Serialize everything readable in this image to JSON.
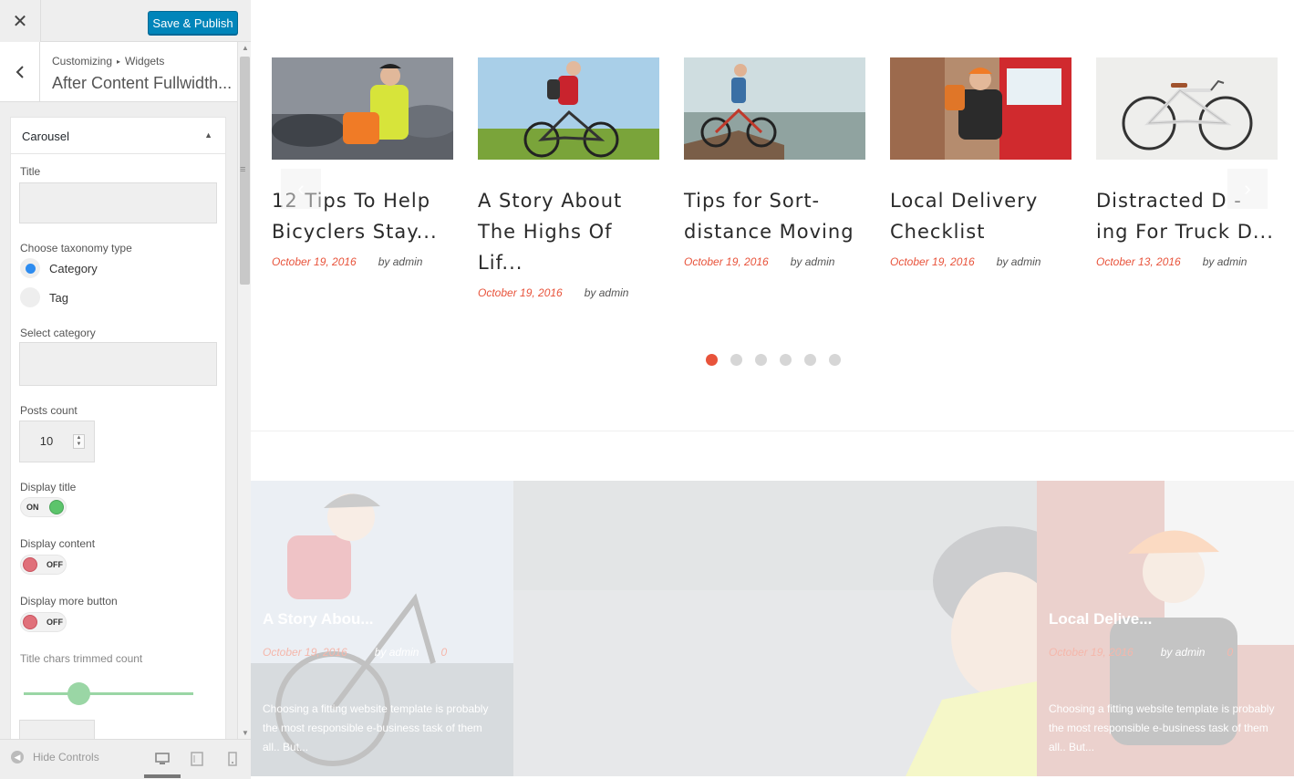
{
  "customizer": {
    "close_icon": "close-icon",
    "publish_label": "Save & Publish",
    "breadcrumb": {
      "root": "Customizing",
      "current": "Widgets"
    },
    "section_title": "After Content Fullwidth...",
    "widget": {
      "title": "Carousel",
      "fields": {
        "title_label": "Title",
        "title_value": "",
        "taxonomy_label": "Choose taxonomy type",
        "taxonomy_options": [
          "Category",
          "Tag"
        ],
        "taxonomy_selected": "Category",
        "category_label": "Select category",
        "category_value": "",
        "posts_count_label": "Posts count",
        "posts_count_value": "10",
        "display_title_label": "Display title",
        "display_title_state": "ON",
        "display_content_label": "Display content",
        "display_content_state": "OFF",
        "display_more_label": "Display more button",
        "display_more_state": "OFF",
        "trim_label": "Title chars trimmed count"
      }
    },
    "footer": {
      "hide_controls": "Hide Controls"
    }
  },
  "preview": {
    "carousel": [
      {
        "title": "12 Tips To Help Bicyclers Stay...",
        "date": "October 19, 2016",
        "author": "by admin"
      },
      {
        "title": "A Story About The Highs Of Lif...",
        "date": "October 19, 2016",
        "author": "by admin"
      },
      {
        "title": "Tips for Sort-distance Moving",
        "date": "October 19, 2016",
        "author": "by admin"
      },
      {
        "title": "Local Delivery Checklist",
        "date": "October 19, 2016",
        "author": "by admin"
      },
      {
        "title": "Distracted D - ing For Truck D...",
        "date": "October 13, 2016",
        "author": "by admin"
      }
    ],
    "pagination": {
      "count": 6,
      "active": 1
    },
    "hero": [
      {
        "title": "A Story Abou...",
        "date": "October 19, 2016",
        "author": "by admin",
        "comment": "0",
        "excerpt": "Choosing a fitting website template is probably the most responsible e-business task of them all.. But..."
      },
      {
        "title": "Local Delive...",
        "date": "October 19, 2016",
        "author": "by admin",
        "comment": "0",
        "excerpt": "Choosing a fitting website template is probably the most responsible e-business task of them all.. But..."
      }
    ]
  },
  "colors": {
    "accent": "#e8533b",
    "publish": "#0085ba",
    "toggle_on": "#5cc46b",
    "toggle_off": "#e0707a"
  }
}
